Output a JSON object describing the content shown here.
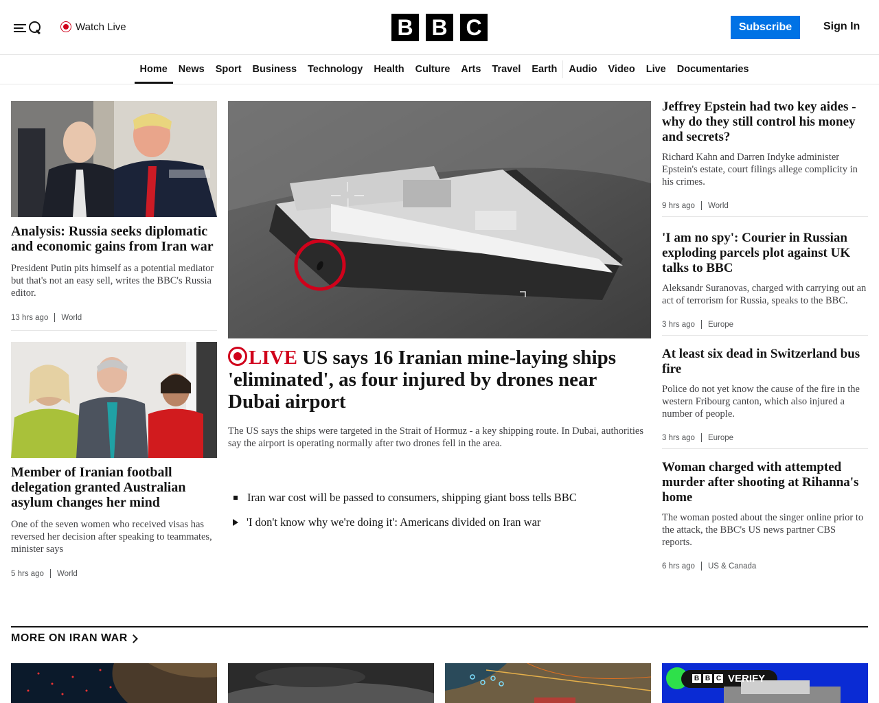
{
  "header": {
    "watch_live": "Watch Live",
    "logo_letters": [
      "B",
      "B",
      "C"
    ],
    "subscribe": "Subscribe",
    "sign_in": "Sign In"
  },
  "nav": {
    "items": [
      "Home",
      "News",
      "Sport",
      "Business",
      "Technology",
      "Health",
      "Culture",
      "Arts",
      "Travel",
      "Earth",
      "Audio",
      "Video",
      "Live",
      "Documentaries"
    ],
    "active": "Home"
  },
  "left": [
    {
      "headline": "Analysis: Russia seeks diplomatic and economic gains from Iran war",
      "summary": "President Putin pits himself as a potential mediator but that's not an easy sell, writes the BBC's Russia editor.",
      "time": "13 hrs ago",
      "section": "World"
    },
    {
      "headline": "Member of Iranian football delegation granted Australian asylum changes her mind",
      "summary": "One of the seven women who received visas has reversed her decision after speaking to teammates, minister says",
      "time": "5 hrs ago",
      "section": "World"
    }
  ],
  "lead": {
    "live_label": "LIVE",
    "headline": "US says 16 Iranian mine-laying ships 'eliminated', as four injured by drones near Dubai airport",
    "summary": "The US says the ships were targeted in the Strait of Hormuz - a key shipping route. In Dubai, authorities say the airport is operating normally after two drones fell in the area.",
    "related": [
      "Iran war cost will be passed to consumers, shipping giant boss tells BBC",
      "'I don't know why we're doing it': Americans divided on Iran war"
    ]
  },
  "right": [
    {
      "headline": "Jeffrey Epstein had two key aides - why do they still control his money and secrets?",
      "summary": "Richard Kahn and Darren Indyke administer Epstein's estate, court filings allege complicity in his crimes.",
      "time": "9 hrs ago",
      "section": "World"
    },
    {
      "headline": "'I am no spy': Courier in Russian exploding parcels plot against UK talks to BBC",
      "summary": "Aleksandr Suranovas, charged with carrying out an act of terrorism for Russia, speaks to the BBC.",
      "time": "3 hrs ago",
      "section": "Europe"
    },
    {
      "headline": "At least six dead in Switzerland bus fire",
      "summary": "Police do not yet know the cause of the fire in the western Fribourg canton, which also injured a number of people.",
      "time": "3 hrs ago",
      "section": "Europe"
    },
    {
      "headline": "Woman charged with attempted murder after shooting at Rihanna's home",
      "summary": "The woman posted about the singer online prior to the attack, the BBC's US news partner CBS reports.",
      "time": "6 hrs ago",
      "section": "US & Canada"
    }
  ],
  "more": {
    "title": "MORE ON IRAN WAR",
    "verify_label": "VERIFY",
    "verify_logo": [
      "B",
      "B",
      "C"
    ]
  },
  "colors": {
    "accent_blue": "#0072e5",
    "live_red": "#d0021b",
    "text": "#141414"
  }
}
